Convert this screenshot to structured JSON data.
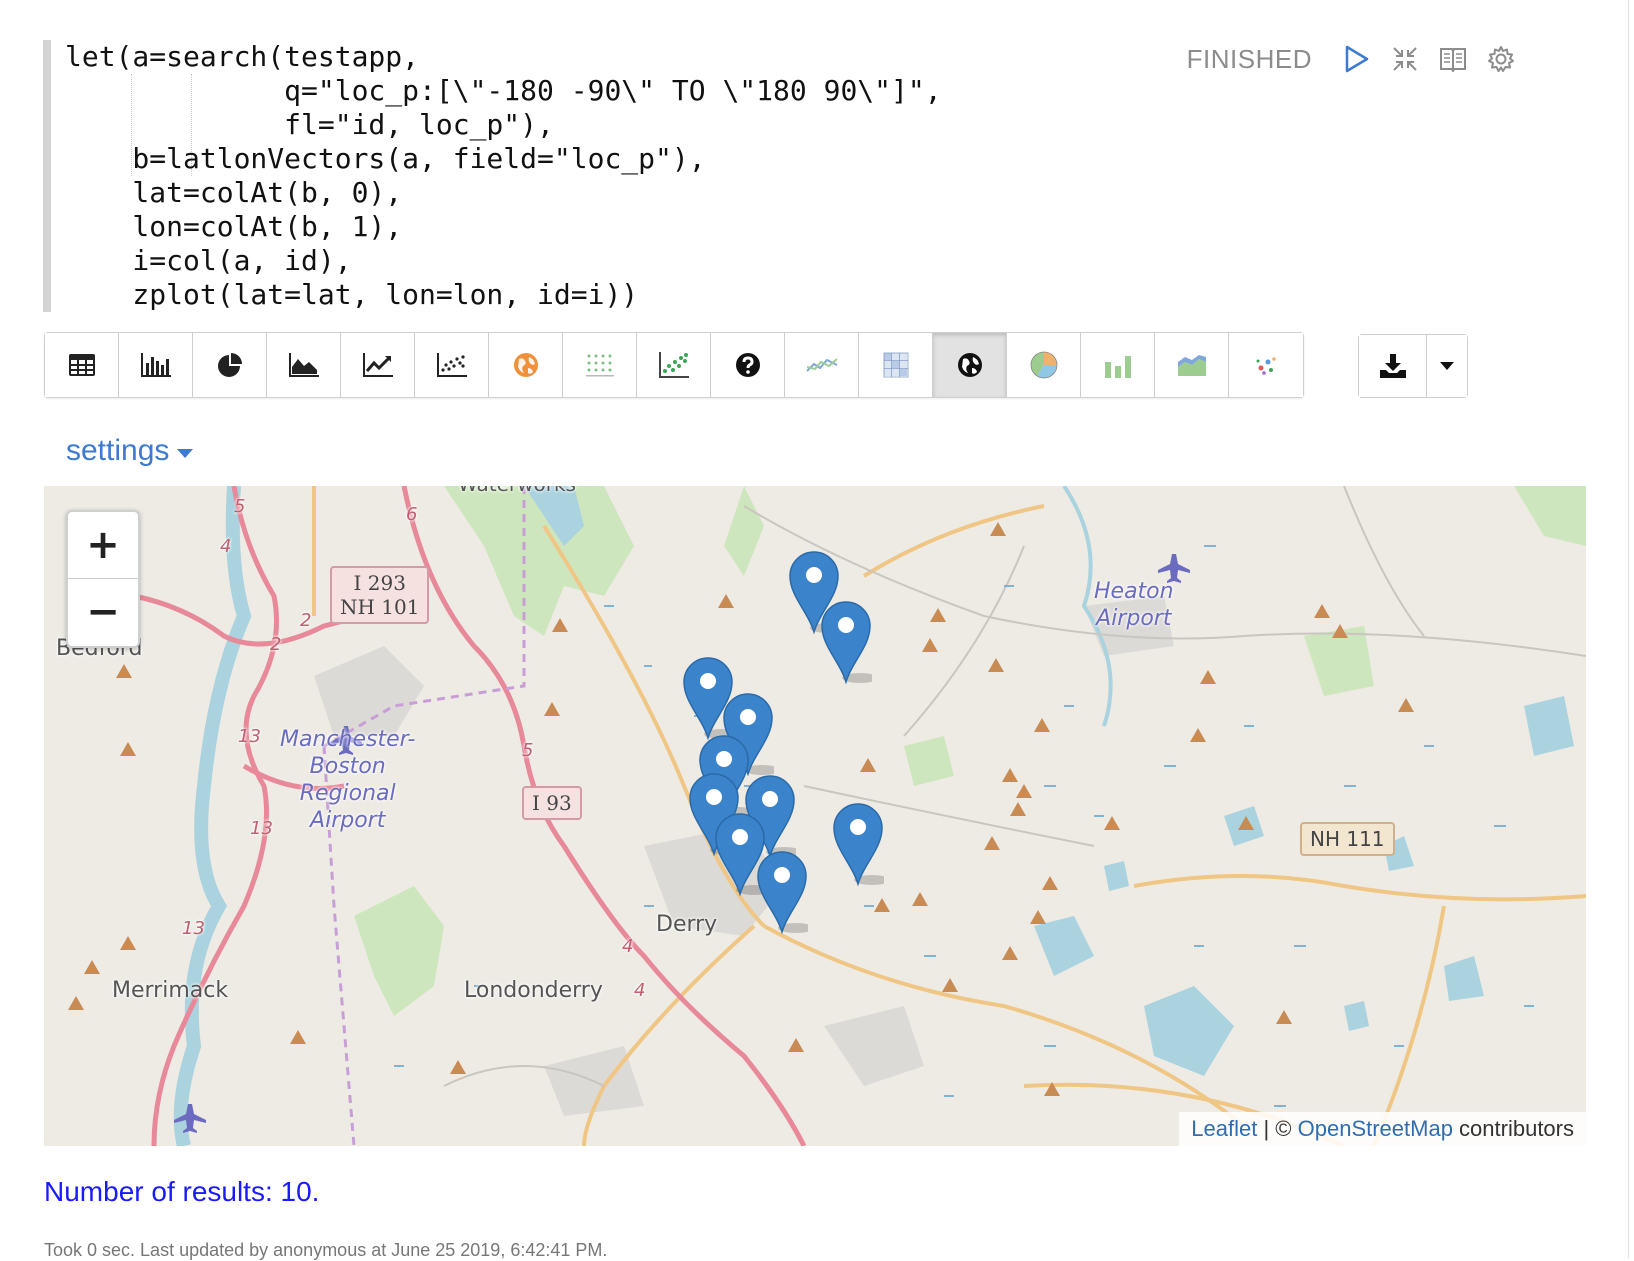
{
  "paragraph": {
    "code_lines": [
      "let(a=search(testapp,",
      "             q=\"loc_p:[\\\"-180 -90\\\" TO \\\"180 90\\\"]\",",
      "             fl=\"id, loc_p\"),",
      "    b=latlonVectors(a, field=\"loc_p\"),",
      "    lat=colAt(b, 0),",
      "    lon=colAt(b, 1),",
      "    i=col(a, id),",
      "    zplot(lat=lat, lon=lon, id=i))"
    ],
    "status": "FINISHED",
    "status_icons": [
      "run-icon",
      "collapse-icon",
      "book-icon",
      "gear-icon"
    ]
  },
  "viz_buttons": [
    {
      "name": "table-icon",
      "active": false
    },
    {
      "name": "bar-chart-icon",
      "active": false
    },
    {
      "name": "pie-chart-icon",
      "active": false
    },
    {
      "name": "area-chart-icon",
      "active": false
    },
    {
      "name": "line-chart-icon",
      "active": false
    },
    {
      "name": "scatter-chart-icon",
      "active": false
    },
    {
      "name": "globe-orange-icon",
      "active": false
    },
    {
      "name": "dot-grid-icon",
      "active": false
    },
    {
      "name": "scatter-color-icon",
      "active": false
    },
    {
      "name": "help-icon",
      "active": false
    },
    {
      "name": "multi-line-icon",
      "active": false
    },
    {
      "name": "heatmap-icon",
      "active": false
    },
    {
      "name": "map-globe-icon",
      "active": true
    },
    {
      "name": "pie-color-icon",
      "active": false
    },
    {
      "name": "bar-color-icon",
      "active": false
    },
    {
      "name": "area-color-icon",
      "active": false
    },
    {
      "name": "bubble-icon",
      "active": false
    }
  ],
  "download": {
    "download_icon": "download-icon",
    "dropdown_icon": "caret-down-icon"
  },
  "settings": {
    "label": "settings"
  },
  "map": {
    "places": {
      "bedford": "Bedford",
      "merrimack": "Merrimack",
      "londonderry": "Londonderry",
      "derry": "Derry",
      "waterworks": "Waterworks",
      "airport_main": "Manchester-\nBoston\nRegional\nAirport",
      "airport_heaton": "Heaton\nAirport"
    },
    "shields": {
      "i293": "I 293\nNH 101",
      "i93": "I 93",
      "nh111": "NH 111"
    },
    "route_numbers": [
      "5",
      "6",
      "4",
      "2",
      "2",
      "13",
      "13",
      "13",
      "5",
      "4",
      "4"
    ],
    "zoom_in": "+",
    "zoom_out": "−",
    "attribution": {
      "leaflet": "Leaflet",
      "sep": " | © ",
      "osm": "OpenStreetMap",
      "rest": " contributors"
    },
    "marker_count": 10,
    "colors": {
      "marker": "#3b83cb",
      "road": "#e8899a",
      "secondary": "#f0c685",
      "water": "#aad3df",
      "park": "#c8e5b6"
    }
  },
  "results": {
    "text": "Number of results: 10."
  },
  "footer": {
    "text": "Took 0 sec. Last updated by anonymous at June 25 2019, 6:42:41 PM."
  }
}
